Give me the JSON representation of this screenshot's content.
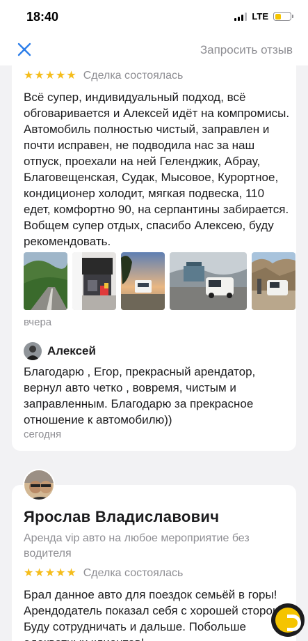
{
  "status_bar": {
    "time": "18:40",
    "network": "LTE",
    "battery_level": 0.4
  },
  "nav": {
    "close_icon": "close-icon",
    "request_review": "Запросить отзыв"
  },
  "colors": {
    "star": "#f5bd1c",
    "secondary_text": "#8e8e93",
    "accent": "#f5c400",
    "background": "#f2f2f4"
  },
  "reviews": [
    {
      "rating": 5,
      "status": "Сделка состоялась",
      "text": "Всё супер, индивидуальный подход, всё обговаривается и Алексей идёт на компромисы. Автомобиль полностью чистый, заправлен и почти исправен, не подводила нас за наш отпуск, проехали на ней Геленджик, Абрау, Благовещенская, Судак, Мысовое, Курортное, кондиционер холодит, мягкая подвеска, 110 едет, комфортно 90, на серпантины забирается. Вобщем супер отдых, спасибо Алексею, буду рекомендовать.",
      "photos": [
        "photo-1",
        "photo-2",
        "photo-3",
        "photo-4",
        "photo-5"
      ],
      "date": "вчера",
      "reply": {
        "author": "Алексей",
        "text": "Благодарю , Егор, прекрасный арендатор, вернул авто четко , вовремя, чистым и заправленным. Благодарю за прекрасное отношение к автомобилю))",
        "date": "сегодня"
      }
    },
    {
      "author": "Ярослав Владиславович",
      "service": "Аренда vip авто на любое мероприятие без водителя",
      "rating": 5,
      "status": "Сделка состоялась",
      "text": "Брал данное авто для поездок семьёй в горы! Арендодатель показал себя с хорошей стороны. Буду сотрудничать и дальше. Побольше адекватных клиентов!"
    }
  ]
}
